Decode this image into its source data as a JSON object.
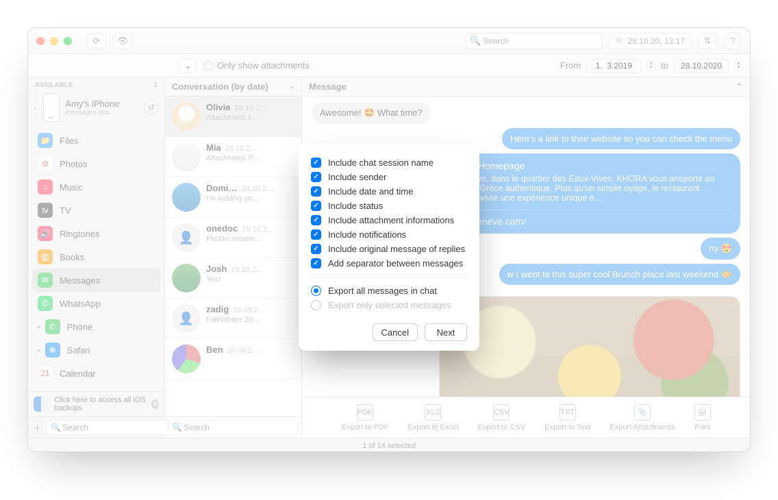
{
  "titlebar": {
    "search_placeholder": "Search",
    "backup_date": "28.10.20, 13:17"
  },
  "filter": {
    "only_attachments": "Only show attachments",
    "from_label": "From",
    "from_value": "1.  3.2019",
    "to_label": "to",
    "to_value": "28.10.2020"
  },
  "sidebar": {
    "header": "AVAILABLE",
    "count": "1",
    "device_name": "Amy's iPhone",
    "device_sub": "messages ans…",
    "items": [
      {
        "label": "Files",
        "color": "#3aa0ff",
        "glyph": "📁"
      },
      {
        "label": "Photos",
        "color": "#ffffff",
        "glyph": "✿",
        "txtcolor": "#e65"
      },
      {
        "label": "Music",
        "color": "#ff3b5c",
        "glyph": "♪"
      },
      {
        "label": "TV",
        "color": "#4a4a4a",
        "glyph": "tv"
      },
      {
        "label": "Ringtones",
        "color": "#ff3366",
        "glyph": "🔊"
      },
      {
        "label": "Books",
        "color": "#ff9500",
        "glyph": "▥"
      },
      {
        "label": "Messages",
        "color": "#34c759",
        "glyph": "✉",
        "selected": true
      },
      {
        "label": "WhatsApp",
        "color": "#25d366",
        "glyph": "✆"
      },
      {
        "label": "Phone",
        "color": "#34c759",
        "glyph": "✆",
        "expand": true
      },
      {
        "label": "Safari",
        "color": "#1e90ff",
        "glyph": "❋",
        "expand": true
      },
      {
        "label": "Calendar",
        "color": "#ffffff",
        "glyph": "21",
        "txtcolor": "#e33"
      }
    ],
    "note": "Click here to access all iOS backups",
    "search_placeholder": "Search"
  },
  "conv_column": {
    "header": "Conversation (by date)",
    "search_placeholder": "Search",
    "list": [
      {
        "name": "Olivia",
        "date": "28.10.2…",
        "preview": "Attachment: i…",
        "av": "av1",
        "selected": true
      },
      {
        "name": "Mia",
        "date": "28.10.2…",
        "preview": "Attachment: P…",
        "av": "av2"
      },
      {
        "name": "Domi…",
        "date": "26.10.2…",
        "preview": "I'm kidding yo…",
        "av": "av3"
      },
      {
        "name": "onedoc",
        "date": "19.10.2…",
        "preview": "Please remem…",
        "av": "av4"
      },
      {
        "name": "Josh",
        "date": "15.10.2…",
        "preview": "Yes!",
        "av": "av5"
      },
      {
        "name": "zadig",
        "date": "26.09.2…",
        "preview": "Fall/Winter 20…",
        "av": "av6"
      },
      {
        "name": "Ben",
        "date": "20.08.2…",
        "preview": "",
        "av": "av7"
      }
    ]
  },
  "message_panel": {
    "header": "Message",
    "msgs": {
      "m0": "Awesome! 🤩 What time?",
      "m1": "Here's a link to their website so you can check the menu",
      "link_title": "staurant - Homepage",
      "link_desc": "tué à Genève, dans le quartier des Eaux-Vives, KHORA vous ansporte au coeur de la Grèce authentique. Plus qu'un simple oyage, le restaurant propose de vivre une expérience unique e…",
      "link_url": "w.khora-geneve.com/",
      "m2": "ny 😍",
      "m3": "w I went to this super cool Brunch place last weekend 🧇"
    }
  },
  "export_bar": {
    "items": [
      "Export to PDF",
      "Export to Excel",
      "Export to CSV",
      "Export to Text",
      "Export Attachments",
      "Print"
    ]
  },
  "status": "1 of 14 selected",
  "modal": {
    "options": [
      "Include chat session name",
      "Include sender",
      "Include date and time",
      "Include status",
      "Include attachment informations",
      "Include notifications",
      "Include original message of replies",
      "Add separator between messages"
    ],
    "radio_all": "Export all messages in chat",
    "radio_selected": "Export only selected messages",
    "cancel": "Cancel",
    "next": "Next"
  }
}
